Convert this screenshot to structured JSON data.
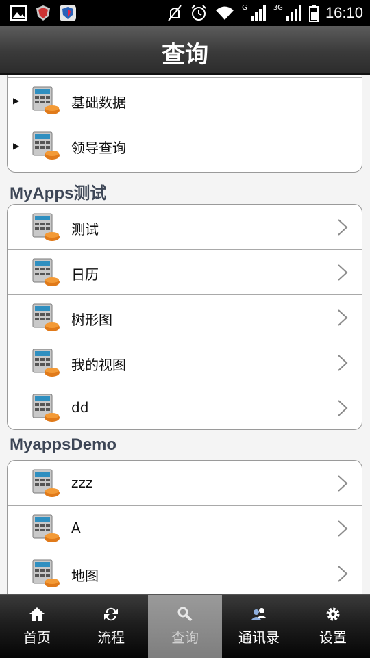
{
  "status_bar": {
    "time": "16:10",
    "network_1": "G",
    "network_2": "3G"
  },
  "title": "查询",
  "groups": [
    {
      "header": "",
      "items": [
        {
          "label": "基础数据",
          "expandable": true
        },
        {
          "label": "领导查询",
          "expandable": true
        }
      ]
    },
    {
      "header": "MyApps测试",
      "items": [
        {
          "label": "测试"
        },
        {
          "label": "日历"
        },
        {
          "label": "树形图"
        },
        {
          "label": "我的视图"
        },
        {
          "label": "dd"
        }
      ]
    },
    {
      "header": "MyappsDemo",
      "items": [
        {
          "label": "zzz"
        },
        {
          "label": "A"
        },
        {
          "label": "地图"
        }
      ]
    }
  ],
  "tabs": [
    {
      "label": "首页",
      "icon": "home-icon"
    },
    {
      "label": "流程",
      "icon": "workflow-icon"
    },
    {
      "label": "查询",
      "icon": "search-icon",
      "active": true
    },
    {
      "label": "通讯录",
      "icon": "contacts-icon"
    },
    {
      "label": "设置",
      "icon": "gear-icon"
    }
  ],
  "colors": {
    "section_header": "#3d4656",
    "active_tab": "#8c8c8c",
    "divider": "#a9a9a9"
  }
}
